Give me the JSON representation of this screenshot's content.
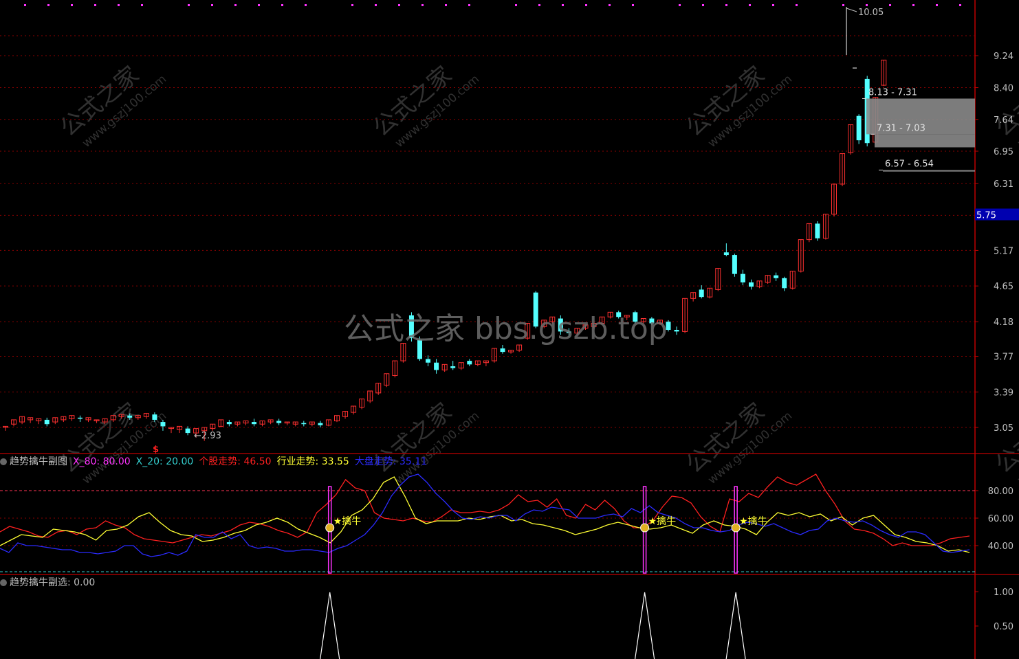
{
  "colors": {
    "bg": "#000000",
    "grid": "#8b0000",
    "axis_text": "#c0c0c0",
    "up": "#ff3030",
    "down": "#54ffff",
    "ind_red": "#ff2020",
    "ind_yellow": "#ffff33",
    "ind_blue": "#2b2bff",
    "signal": "#ff33ff",
    "watermark": "#5a5a5a",
    "price_tag_bg": "#0000b0"
  },
  "watermark": {
    "big_text": "公式之家 bbs.gszb.top",
    "tile_cn": "公式之家",
    "tile_url": "www.gszj100.com"
  },
  "main_panel": {
    "y_ticks": [
      "9.24",
      "8.40",
      "7.64",
      "6.95",
      "6.31",
      "5.74",
      "5.17",
      "4.65",
      "4.18",
      "3.77",
      "3.39",
      "3.05"
    ],
    "y_tick_values": [
      9.24,
      8.4,
      7.64,
      6.95,
      6.31,
      5.74,
      5.17,
      4.65,
      4.18,
      3.77,
      3.39,
      3.05
    ],
    "max_label": "10.05",
    "min_label": "2.93",
    "current_price": "5.75",
    "gap_boxes": [
      "8.13 - 7.31",
      "7.31 - 7.03",
      "6.57 - 6.54"
    ],
    "signal_marker": "$"
  },
  "indicator_panel": {
    "title": "趋势擒牛副图",
    "x80_label": "X_80: 80.00",
    "x20_label": "X_20: 20.00",
    "stock_label": "个股走势: 46.50",
    "industry_label": "行业走势: 33.55",
    "market_label": "大盘走势: 35.11",
    "y_ticks": [
      "80.00",
      "60.00",
      "40.00"
    ],
    "signal_text": "擒牛"
  },
  "select_panel": {
    "title": "趋势擒牛副选",
    "value_label": ": 0.00",
    "y_ticks": [
      "1.00",
      "0.50"
    ]
  },
  "chart_data": [
    {
      "type": "candlestick",
      "series": [
        {
          "name": "",
          "values": [
            [
              3.05,
              3.06,
              3.02,
              3.04
            ],
            [
              3.08,
              3.12,
              3.06,
              3.1
            ],
            [
              3.1,
              3.15,
              3.08,
              3.12
            ],
            [
              3.12,
              3.14,
              3.09,
              3.11
            ],
            [
              3.11,
              3.13,
              3.08,
              3.1
            ],
            [
              3.12,
              3.08,
              3.14,
              3.06
            ],
            [
              3.1,
              3.14,
              3.08,
              3.12
            ],
            [
              3.12,
              3.15,
              3.1,
              3.13
            ],
            [
              3.13,
              3.16,
              3.11,
              3.14
            ],
            [
              3.14,
              3.13,
              3.16,
              3.1
            ],
            [
              3.12,
              3.14,
              3.1,
              3.11
            ],
            [
              3.11,
              3.12,
              3.09,
              3.1
            ],
            [
              3.1,
              3.13,
              3.08,
              3.12
            ],
            [
              3.12,
              3.16,
              3.1,
              3.15
            ],
            [
              3.15,
              3.17,
              3.13,
              3.16
            ],
            [
              3.16,
              3.14,
              3.18,
              3.12
            ],
            [
              3.14,
              3.16,
              3.12,
              3.15
            ],
            [
              3.15,
              3.18,
              3.13,
              3.17
            ],
            [
              3.17,
              3.12,
              3.19,
              3.1
            ],
            [
              3.1,
              3.06,
              3.12,
              3.02
            ],
            [
              3.04,
              3.05,
              3.0,
              3.03
            ],
            [
              3.03,
              3.06,
              3.0,
              3.04
            ],
            [
              3.04,
              3.0,
              3.06,
              2.98
            ],
            [
              3.0,
              3.04,
              2.96,
              3.02
            ],
            [
              3.02,
              3.05,
              2.93,
              3.04
            ],
            [
              3.04,
              3.08,
              3.02,
              3.06
            ],
            [
              3.06,
              3.12,
              3.05,
              3.1
            ],
            [
              3.1,
              3.08,
              3.12,
              3.06
            ],
            [
              3.08,
              3.1,
              3.06,
              3.09
            ],
            [
              3.09,
              3.11,
              3.07,
              3.1
            ],
            [
              3.1,
              3.08,
              3.13,
              3.06
            ],
            [
              3.08,
              3.11,
              3.06,
              3.1
            ],
            [
              3.1,
              3.12,
              3.08,
              3.11
            ],
            [
              3.11,
              3.09,
              3.13,
              3.07
            ],
            [
              3.09,
              3.1,
              3.07,
              3.08
            ],
            [
              3.08,
              3.1,
              3.06,
              3.09
            ],
            [
              3.09,
              3.08,
              3.11,
              3.06
            ],
            [
              3.08,
              3.1,
              3.06,
              3.09
            ],
            [
              3.09,
              3.07,
              3.11,
              3.05
            ],
            [
              3.07,
              3.12,
              3.06,
              3.11
            ],
            [
              3.11,
              3.16,
              3.1,
              3.15
            ],
            [
              3.15,
              3.2,
              3.13,
              3.19
            ],
            [
              3.19,
              3.25,
              3.17,
              3.24
            ],
            [
              3.24,
              3.32,
              3.22,
              3.3
            ],
            [
              3.3,
              3.4,
              3.28,
              3.38
            ],
            [
              3.38,
              3.48,
              3.36,
              3.46
            ],
            [
              3.46,
              3.58,
              3.44,
              3.56
            ],
            [
              3.56,
              3.72,
              3.54,
              3.7
            ],
            [
              3.72,
              3.92,
              3.7,
              3.9
            ],
            [
              4.26,
              3.98,
              4.3,
              3.94
            ],
            [
              3.96,
              3.74,
              4.0,
              3.72
            ],
            [
              3.74,
              3.7,
              3.78,
              3.66
            ],
            [
              3.7,
              3.62,
              3.74,
              3.58
            ],
            [
              3.62,
              3.68,
              3.6,
              3.66
            ],
            [
              3.66,
              3.64,
              3.72,
              3.62
            ],
            [
              3.64,
              3.7,
              3.62,
              3.68
            ],
            [
              3.72,
              3.68,
              3.74,
              3.66
            ],
            [
              3.68,
              3.72,
              3.66,
              3.7
            ],
            [
              3.7,
              3.72,
              3.66,
              3.71
            ],
            [
              3.72,
              3.86,
              3.7,
              3.84
            ],
            [
              3.86,
              3.82,
              3.9,
              3.8
            ],
            [
              3.82,
              3.84,
              3.8,
              3.83
            ],
            [
              3.84,
              3.9,
              3.82,
              3.88
            ],
            [
              3.98,
              4.16,
              3.96,
              4.14
            ],
            [
              4.56,
              4.12,
              4.58,
              4.1
            ],
            [
              4.12,
              4.2,
              4.1,
              4.18
            ],
            [
              4.18,
              4.24,
              4.16,
              4.22
            ],
            [
              4.22,
              4.06,
              4.26,
              4.02
            ],
            [
              4.06,
              4.04,
              4.1,
              4.0
            ],
            [
              4.04,
              4.1,
              4.02,
              4.08
            ],
            [
              4.1,
              4.14,
              4.08,
              4.12
            ],
            [
              4.12,
              4.16,
              4.1,
              4.14
            ],
            [
              4.16,
              4.24,
              4.14,
              4.22
            ],
            [
              4.24,
              4.3,
              4.22,
              4.28
            ],
            [
              4.3,
              4.24,
              4.32,
              4.22
            ],
            [
              4.24,
              4.26,
              4.2,
              4.25
            ],
            [
              4.3,
              4.18,
              4.32,
              4.16
            ],
            [
              4.18,
              4.22,
              4.16,
              4.2
            ],
            [
              4.22,
              4.16,
              4.24,
              4.14
            ],
            [
              4.16,
              4.2,
              4.14,
              4.18
            ],
            [
              4.18,
              4.08,
              4.2,
              4.06
            ],
            [
              4.08,
              4.06,
              4.12,
              4.02
            ],
            [
              4.06,
              4.48,
              4.04,
              4.46
            ],
            [
              4.48,
              4.56,
              4.44,
              4.54
            ],
            [
              4.6,
              4.5,
              4.66,
              4.48
            ],
            [
              4.5,
              4.62,
              4.48,
              4.6
            ],
            [
              4.6,
              4.9,
              4.58,
              4.88
            ],
            [
              5.14,
              5.1,
              5.28,
              5.08
            ],
            [
              5.1,
              4.82,
              5.12,
              4.78
            ],
            [
              4.82,
              4.7,
              4.88,
              4.66
            ],
            [
              4.7,
              4.64,
              4.74,
              4.6
            ],
            [
              4.64,
              4.72,
              4.62,
              4.7
            ],
            [
              4.7,
              4.8,
              4.68,
              4.78
            ],
            [
              4.8,
              4.76,
              4.84,
              4.72
            ],
            [
              4.76,
              4.62,
              4.78,
              4.58
            ],
            [
              4.62,
              4.86,
              4.6,
              4.84
            ],
            [
              4.86,
              5.34,
              4.84,
              5.32
            ],
            [
              5.34,
              5.6,
              5.3,
              5.58
            ],
            [
              5.6,
              5.36,
              5.64,
              5.32
            ],
            [
              5.36,
              5.76,
              5.34,
              5.74
            ],
            [
              5.76,
              6.3,
              5.72,
              6.28
            ],
            [
              6.3,
              6.9,
              6.26,
              6.88
            ],
            [
              6.92,
              7.52,
              6.88,
              7.5
            ],
            [
              7.72,
              7.18,
              7.76,
              7.1
            ],
            [
              8.62,
              7.12,
              8.7,
              7.05
            ],
            [
              7.14,
              8.16,
              7.1,
              8.14
            ],
            [
              8.46,
              9.12,
              8.44,
              9.1
            ]
          ]
        }
      ]
    },
    {
      "type": "line",
      "ylim": [
        20,
        100
      ],
      "series": [
        {
          "name": "个股走势",
          "color": "ind_red",
          "values": [
            50,
            54,
            52,
            50,
            47,
            46,
            50,
            51,
            48,
            52,
            53,
            58,
            55,
            53,
            48,
            45,
            44,
            43,
            42,
            44,
            46,
            48,
            47,
            49,
            51,
            55,
            57,
            56,
            54,
            51,
            49,
            46,
            50,
            64,
            70,
            77,
            88,
            82,
            80,
            64,
            60,
            59,
            58,
            60,
            58,
            57,
            61,
            66,
            64,
            64,
            65,
            64,
            66,
            70,
            77,
            72,
            73,
            68,
            74,
            62,
            60,
            70,
            66,
            73,
            67,
            58,
            53,
            53,
            58,
            68,
            76,
            75,
            71,
            61,
            54,
            50,
            74,
            72,
            78,
            75,
            83,
            90,
            86,
            84,
            88,
            92,
            80,
            70,
            58,
            52,
            51,
            49,
            45,
            40,
            42,
            40,
            40,
            40,
            42,
            45,
            46,
            47
          ]
        },
        {
          "name": "行业走势",
          "color": "ind_yellow",
          "values": [
            40,
            44,
            48,
            47,
            46,
            52,
            51,
            50,
            48,
            44,
            51,
            52,
            55,
            61,
            64,
            57,
            51,
            48,
            47,
            43,
            44,
            46,
            49,
            51,
            55,
            57,
            60,
            57,
            52,
            49,
            46,
            42,
            50,
            62,
            66,
            74,
            86,
            90,
            76,
            60,
            56,
            58,
            58,
            58,
            60,
            59,
            61,
            62,
            58,
            59,
            56,
            55,
            53,
            51,
            48,
            50,
            52,
            55,
            57,
            55,
            53,
            52,
            53,
            55,
            52,
            49,
            55,
            58,
            55,
            54,
            52,
            48,
            57,
            64,
            62,
            64,
            61,
            63,
            58,
            61,
            55,
            60,
            62,
            55,
            48,
            46,
            43,
            42,
            40,
            36,
            37,
            35
          ]
        },
        {
          "name": "大盘走势",
          "color": "ind_blue",
          "values": [
            38,
            35,
            42,
            40,
            40,
            39,
            38,
            37,
            37,
            35,
            35,
            34,
            35,
            36,
            40,
            40,
            34,
            32,
            33,
            35,
            33,
            36,
            48,
            46,
            46,
            50,
            45,
            48,
            40,
            38,
            39,
            38,
            36,
            36,
            37,
            37,
            36,
            35,
            38,
            40,
            44,
            48,
            55,
            64,
            76,
            84,
            90,
            92,
            86,
            78,
            72,
            65,
            60,
            59,
            61,
            60,
            62,
            62,
            58,
            63,
            66,
            65,
            68,
            67,
            66,
            60,
            60,
            60,
            62,
            63,
            61,
            67,
            64,
            69,
            64,
            62,
            60,
            56,
            53,
            53,
            51,
            50,
            51,
            55,
            57,
            56,
            54,
            56,
            53,
            50,
            48,
            51,
            52,
            58,
            60,
            58,
            57,
            58,
            55,
            51,
            48,
            46,
            50,
            50,
            48,
            42,
            36,
            35,
            36,
            37
          ]
        }
      ]
    },
    {
      "type": "bar",
      "ylim": [
        0,
        1
      ],
      "signal_indices": [
        34,
        72,
        83
      ],
      "values": [
        1,
        1,
        1
      ]
    }
  ]
}
